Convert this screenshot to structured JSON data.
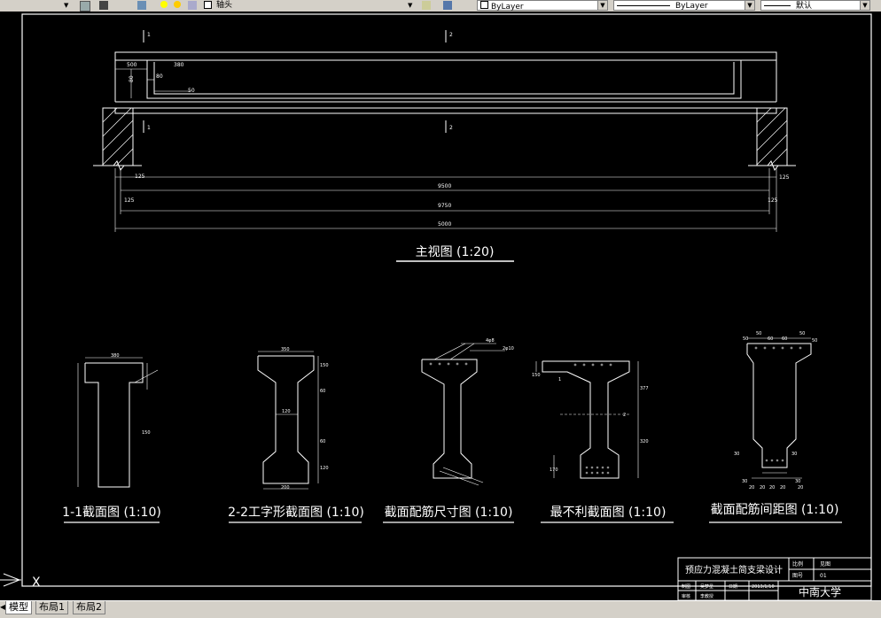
{
  "toolbar": {
    "layer_name": "轴头",
    "color_value": "ByLayer",
    "linetype_value": "ByLayer",
    "lineweight_value": "默认"
  },
  "drawing": {
    "main_view": {
      "title": "主视图 (1:20)",
      "section_marks": [
        "1",
        "2",
        "1",
        "2"
      ],
      "top_dims": [
        "500",
        "380",
        "80",
        "80",
        "50"
      ],
      "end_dims_left": [
        "125",
        "125"
      ],
      "end_dims_right": [
        "125",
        "125"
      ],
      "span_dims": [
        "9500",
        "9750",
        "5000"
      ]
    },
    "sections": [
      {
        "title": "1-1截面图 (1:10)",
        "dims": [
          "380",
          "150"
        ]
      },
      {
        "title": "2-2工字形截面图 (1:10)",
        "dims": [
          "350",
          "150",
          "60",
          "120",
          "60",
          "120",
          "200"
        ]
      },
      {
        "title": "截面配筋尺寸图 (1:10)",
        "dims": [
          "4φ8",
          "2φ10"
        ]
      },
      {
        "title": "最不利截面图 (1:10)",
        "dims": [
          "150",
          "377",
          "320",
          "170",
          "1",
          "2"
        ]
      },
      {
        "title": "截面配筋间距图 (1:10)",
        "dims": [
          "50",
          "50",
          "60",
          "60",
          "50",
          "50",
          "30",
          "30",
          "20",
          "20",
          "20",
          "20",
          "30",
          "30",
          "20"
        ]
      }
    ],
    "title_block": {
      "project": "预应力混凝土简支梁设计",
      "labels": [
        "比例",
        "图号",
        "制图",
        "审核",
        "日期"
      ],
      "values": [
        "见图",
        "01",
        "吴梦星",
        "2013/1/10",
        "李教授"
      ],
      "school": "中南大学"
    },
    "ucs_label": "X"
  },
  "tabs": [
    {
      "label": "模型",
      "active": true
    },
    {
      "label": "布局1",
      "active": false
    },
    {
      "label": "布局2",
      "active": false
    }
  ]
}
